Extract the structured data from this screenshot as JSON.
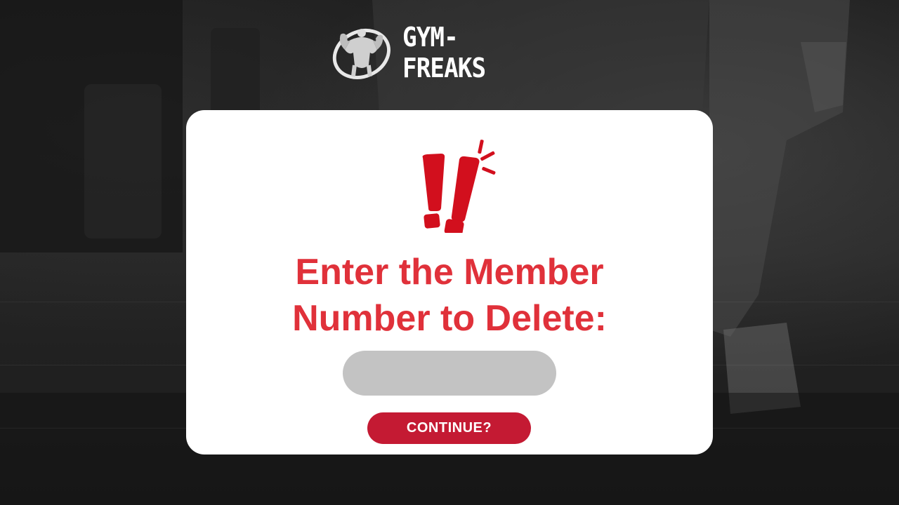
{
  "brand": {
    "name": "GYM-FREAKS",
    "logo_icon": "bodybuilder-logo-icon"
  },
  "dialog": {
    "icon": "exclamation-alert-icon",
    "prompt_line1": "Enter the Member",
    "prompt_line2": "Number to Delete:",
    "member_number_value": "",
    "member_number_placeholder": "",
    "continue_label": "CONTINUE?"
  },
  "colors": {
    "accent_red": "#e0313a",
    "button_red": "#c41a33",
    "input_gray": "#c3c3c3",
    "card_white": "#ffffff"
  }
}
